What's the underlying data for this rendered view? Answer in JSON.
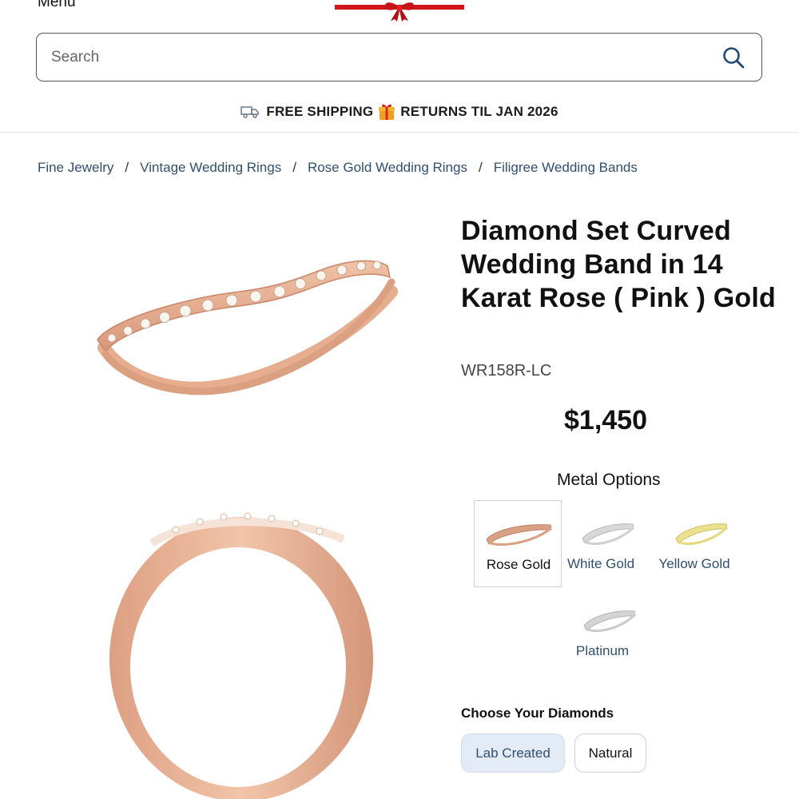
{
  "header": {
    "menu_label": "Menu"
  },
  "search": {
    "placeholder": "Search",
    "value": ""
  },
  "promo": {
    "text_left": "FREE SHIPPING",
    "text_right": "RETURNS TIL JAN 2026"
  },
  "breadcrumb": {
    "items": [
      "Fine Jewelry",
      "Vintage Wedding Rings",
      "Rose Gold Wedding Rings",
      "Filigree Wedding Bands"
    ],
    "separator": "/"
  },
  "product": {
    "title": "Diamond Set Curved Wedding Band in 14 Karat Rose ( Pink ) Gold",
    "sku": "WR158R-LC",
    "price": "$1,450"
  },
  "metal_options": {
    "heading": "Metal Options",
    "selected": "Rose Gold",
    "items": [
      {
        "label": "Rose Gold",
        "color": "#d9a184"
      },
      {
        "label": "White Gold",
        "color": "#c9c9c9"
      },
      {
        "label": "Yellow Gold",
        "color": "#e8dc8a"
      },
      {
        "label": "Platinum",
        "color": "#c6c6c6"
      }
    ]
  },
  "diamonds": {
    "heading": "Choose Your Diamonds",
    "options": [
      "Lab Created",
      "Natural"
    ],
    "selected": "Lab Created"
  },
  "colors": {
    "link": "#2f4f6f",
    "ring_rose": "#e3ab8d",
    "selected_pill_bg": "#e3ecf6",
    "ribbon_red": "#d0161a"
  }
}
